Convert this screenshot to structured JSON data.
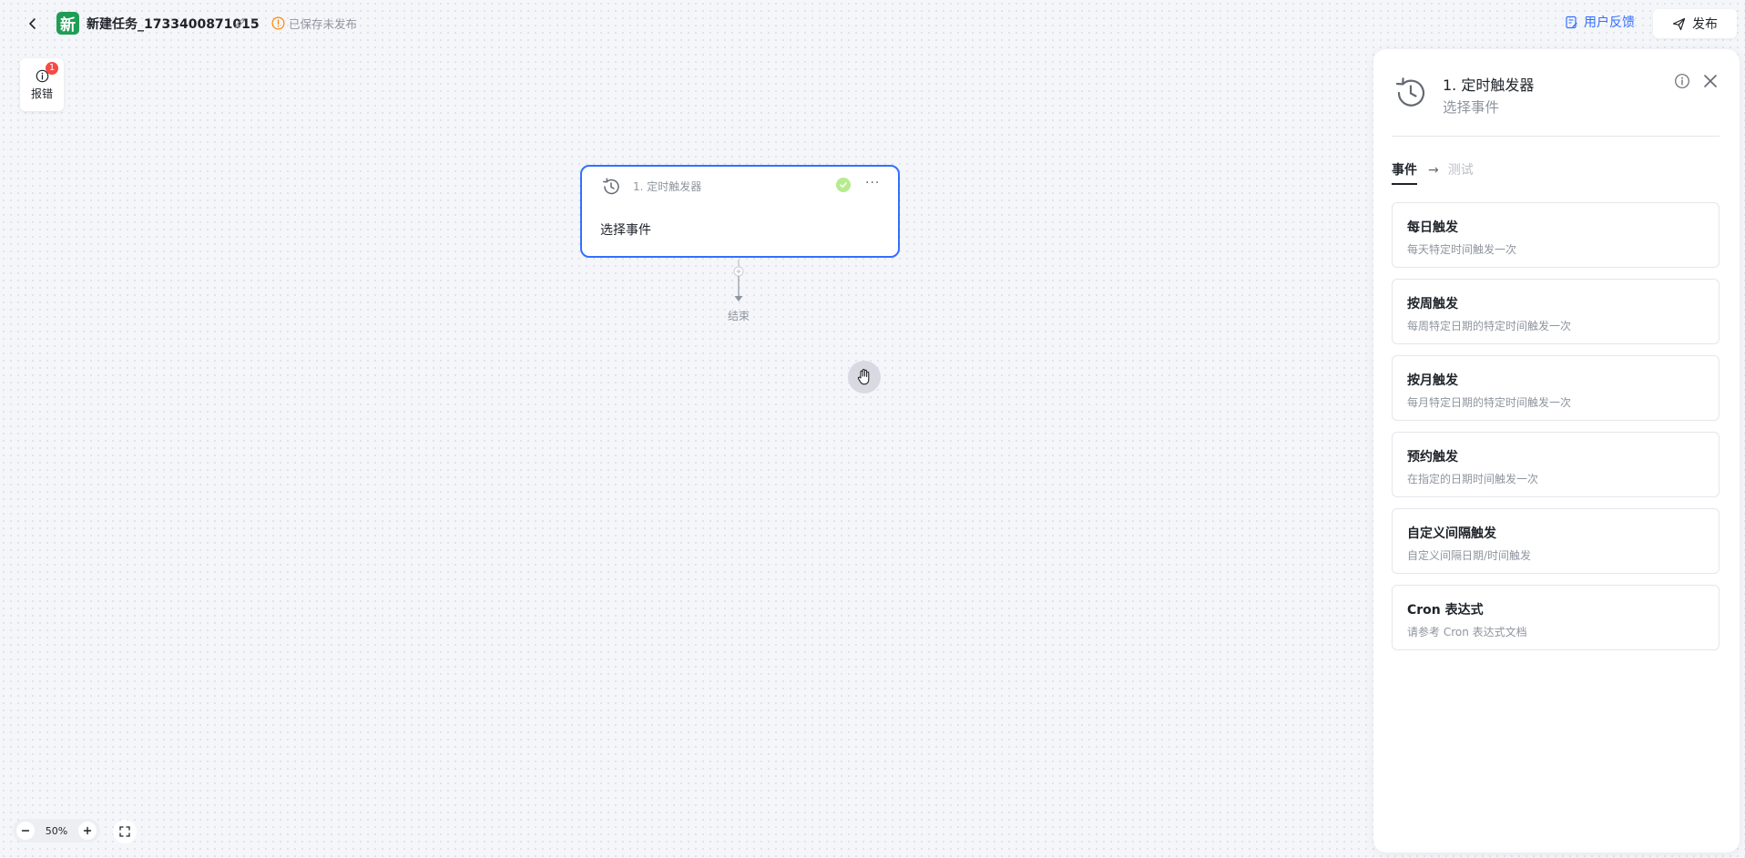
{
  "header": {
    "logo_text": "新",
    "task_title": "新建任务_1733400871015",
    "save_status": "已保存未发布",
    "feedback_label": "用户反馈",
    "publish_label": "发布"
  },
  "report": {
    "label": "报错",
    "badge_count": "1"
  },
  "canvas": {
    "node": {
      "title": "1. 定时触发器",
      "body": "选择事件"
    },
    "end_label": "结束",
    "zoom_level": "50%"
  },
  "panel": {
    "title": "1. 定时触发器",
    "subtitle": "选择事件",
    "tabs": [
      {
        "label": "事件",
        "active": true
      },
      {
        "label": "测试",
        "active": false
      }
    ],
    "options": [
      {
        "title": "每日触发",
        "desc": "每天特定时间触发一次"
      },
      {
        "title": "按周触发",
        "desc": "每周特定日期的特定时间触发一次"
      },
      {
        "title": "按月触发",
        "desc": "每月特定日期的特定时间触发一次"
      },
      {
        "title": "预约触发",
        "desc": "在指定的日期时间触发一次"
      },
      {
        "title": "自定义间隔触发",
        "desc": "自定义间隔日期/时间触发"
      },
      {
        "title": "Cron 表达式",
        "desc": "请参考 Cron 表达式文档"
      }
    ]
  },
  "colors": {
    "accent": "#3370ff",
    "logo_green": "#1f9d55",
    "warning": "#ff8800",
    "badge_red": "#f54a45",
    "success": "#52c41a"
  }
}
